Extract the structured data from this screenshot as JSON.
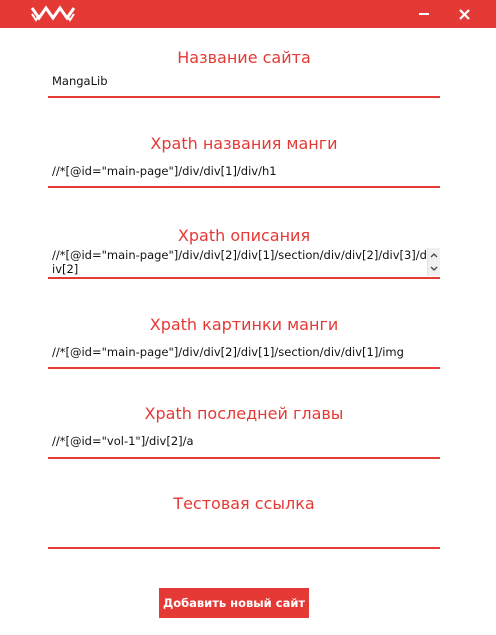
{
  "window": {
    "logo_icon": "zigzag-logo-icon",
    "minimize_icon": "minimize-icon",
    "close_icon": "close-icon",
    "accent_color": "#e53935"
  },
  "fields": [
    {
      "label": "Название сайта",
      "value": "MangaLib"
    },
    {
      "label": "Xpath названия манги",
      "value": "//*[@id=\"main-page\"]/div/div[1]/div/h1"
    },
    {
      "label": "Xpath описания",
      "value": "//*[@id=\"main-page\"]/div/div[2]/div[1]/section/div/div[2]/div[3]/div[2]"
    },
    {
      "label": "Xpath картинки манги",
      "value": "//*[@id=\"main-page\"]/div/div[2]/div[1]/section/div/div[1]/img"
    },
    {
      "label": "Xpath последней главы",
      "value": "//*[@id=\"vol-1\"]/div[2]/a"
    },
    {
      "label": "Тестовая ссылка",
      "value": ""
    }
  ],
  "submit": {
    "label": "Добавить новый сайт"
  }
}
